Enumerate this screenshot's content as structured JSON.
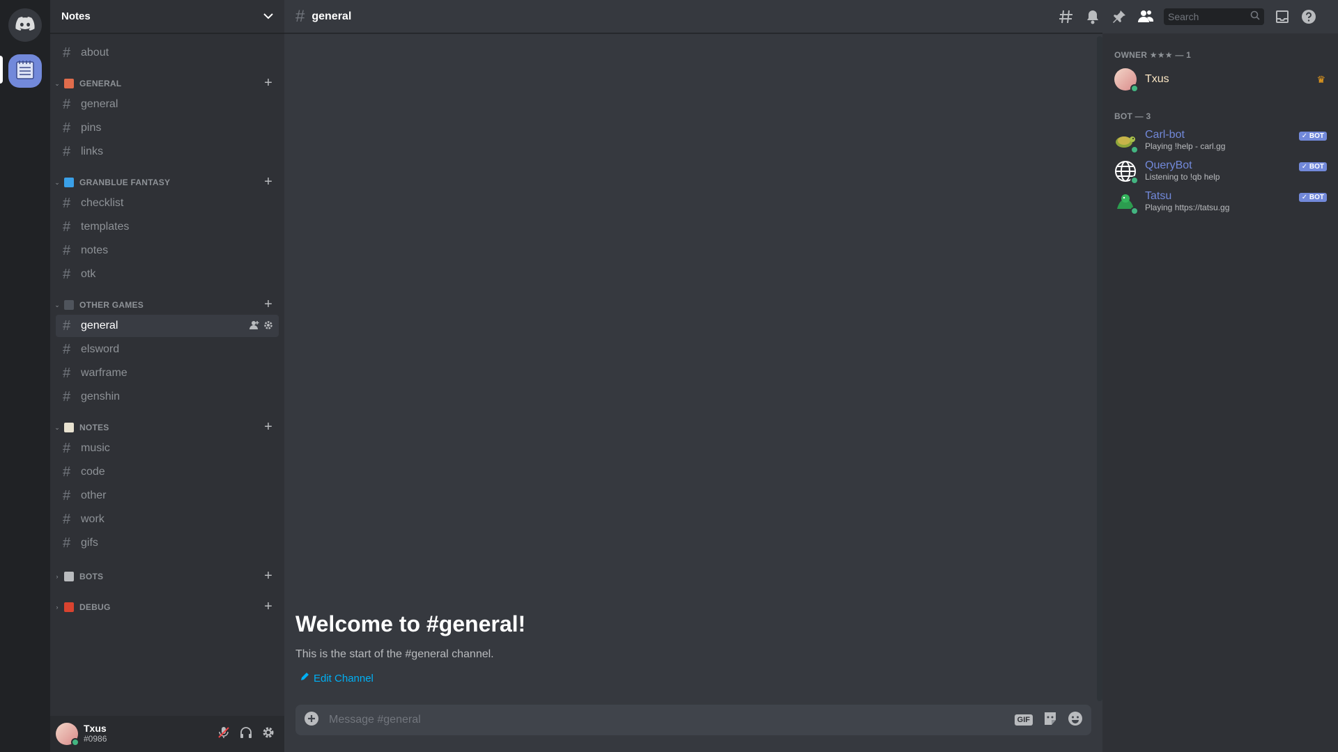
{
  "server": {
    "name": "Notes"
  },
  "sidebar": {
    "top_channels": [
      {
        "label": "about"
      }
    ],
    "categories": [
      {
        "label": "GENERAL",
        "emoji_color": "#e06c4c",
        "channels": [
          {
            "label": "general"
          },
          {
            "label": "pins"
          },
          {
            "label": "links"
          }
        ]
      },
      {
        "label": "GRANBLUE FANTASY",
        "emoji_color": "#3aa0e8",
        "channels": [
          {
            "label": "checklist"
          },
          {
            "label": "templates"
          },
          {
            "label": "notes"
          },
          {
            "label": "otk"
          }
        ]
      },
      {
        "label": "OTHER GAMES",
        "emoji_color": "#4f545c",
        "channels": [
          {
            "label": "general",
            "active": true
          },
          {
            "label": "elsword"
          },
          {
            "label": "warframe"
          },
          {
            "label": "genshin"
          }
        ]
      },
      {
        "label": "NOTES",
        "emoji_color": "#e8e2d0",
        "channels": [
          {
            "label": "music"
          },
          {
            "label": "code"
          },
          {
            "label": "other"
          },
          {
            "label": "work"
          },
          {
            "label": "gifs"
          }
        ]
      },
      {
        "label": "BOTS",
        "emoji_color": "#b9bbbe",
        "collapsed": true,
        "channels": []
      },
      {
        "label": "DEBUG",
        "emoji_color": "#d9432f",
        "collapsed": true,
        "channels": []
      }
    ]
  },
  "user": {
    "name": "Txus",
    "tag": "#0986"
  },
  "channel": {
    "name": "general"
  },
  "welcome": {
    "title": "Welcome to #general!",
    "subtitle": "This is the start of the #general channel.",
    "edit_label": "Edit Channel"
  },
  "composer": {
    "placeholder": "Message #general",
    "gif_label": "GIF"
  },
  "search": {
    "placeholder": "Search"
  },
  "members": {
    "owner_header": "OWNER ★★★ — 1",
    "owner": {
      "name": "Txus",
      "color": "#fce7c4"
    },
    "bot_header": "BOT — 3",
    "bots": [
      {
        "name": "Carl-bot",
        "activity": "Playing !help - carl.gg",
        "tag": "✓ BOT"
      },
      {
        "name": "QueryBot",
        "activity": "Listening to !qb help",
        "tag": "✓ BOT"
      },
      {
        "name": "Tatsu",
        "activity": "Playing https://tatsu.gg",
        "tag": "✓ BOT"
      }
    ]
  },
  "colors": {
    "accent": "#7289da",
    "online": "#43b581",
    "link": "#00b0f4"
  }
}
